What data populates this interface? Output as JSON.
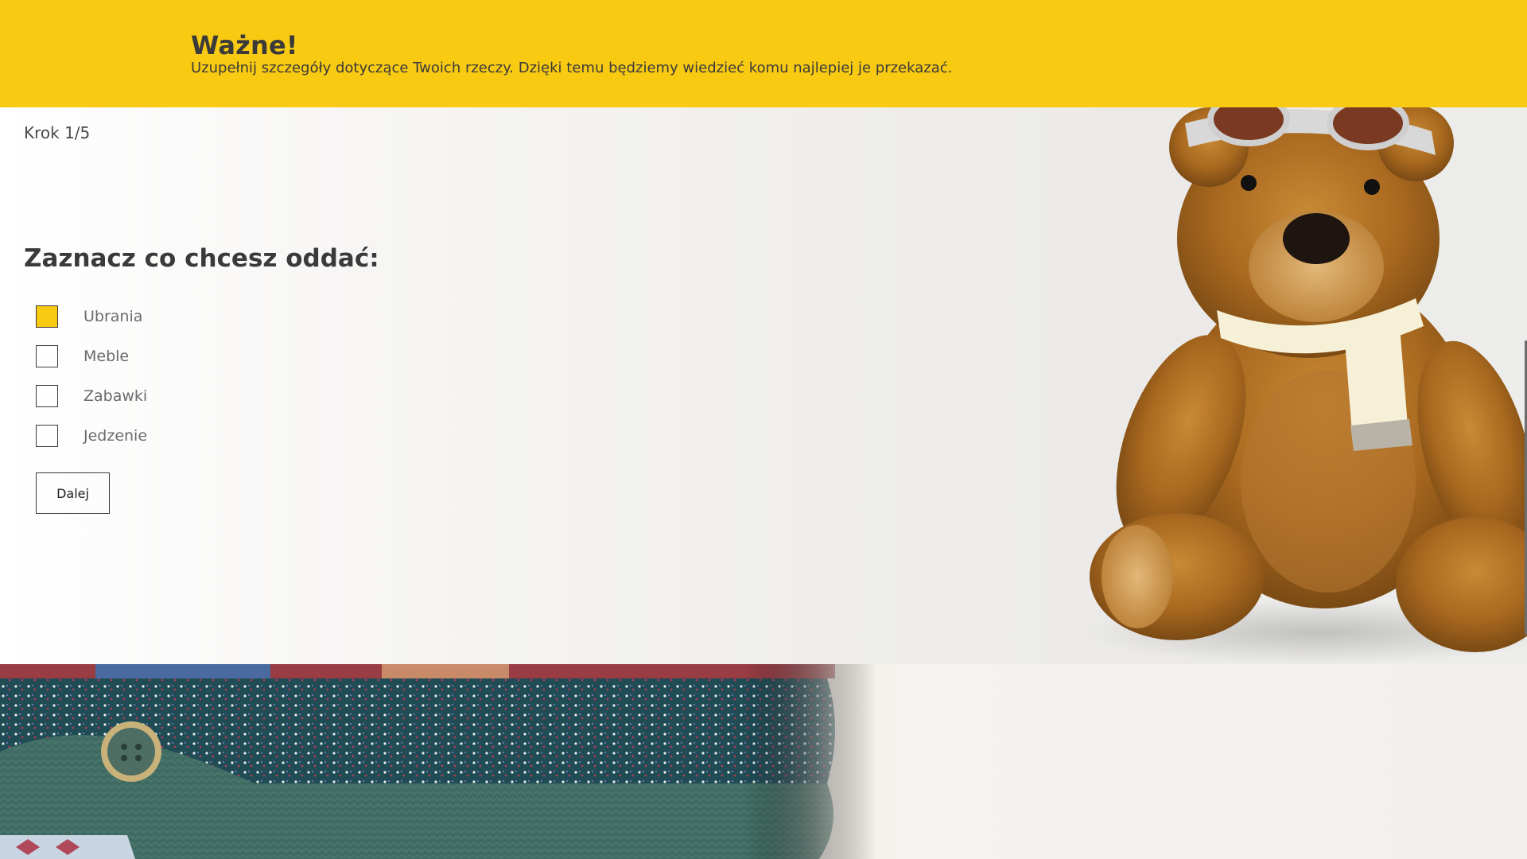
{
  "banner": {
    "title": "Ważne!",
    "text": "Uzupełnij szczegóły dotyczące Twoich rzeczy. Dzięki temu będziemy wiedzieć komu najlepiej je przekazać."
  },
  "form": {
    "step": "Krok 1/5",
    "title": "Zaznacz co chcesz oddać:",
    "options": [
      {
        "label": "Ubrania",
        "checked": true
      },
      {
        "label": "Meble",
        "checked": false
      },
      {
        "label": "Zabawki",
        "checked": false
      },
      {
        "label": "Jedzenie",
        "checked": false
      }
    ],
    "next_label": "Dalej"
  },
  "colors": {
    "accent": "#f9ca12",
    "text_dark": "#3a3a3a"
  },
  "icons": {
    "decorative_bear": "teddy-bear-image",
    "decorative_clothes": "folded-clothes-image"
  }
}
